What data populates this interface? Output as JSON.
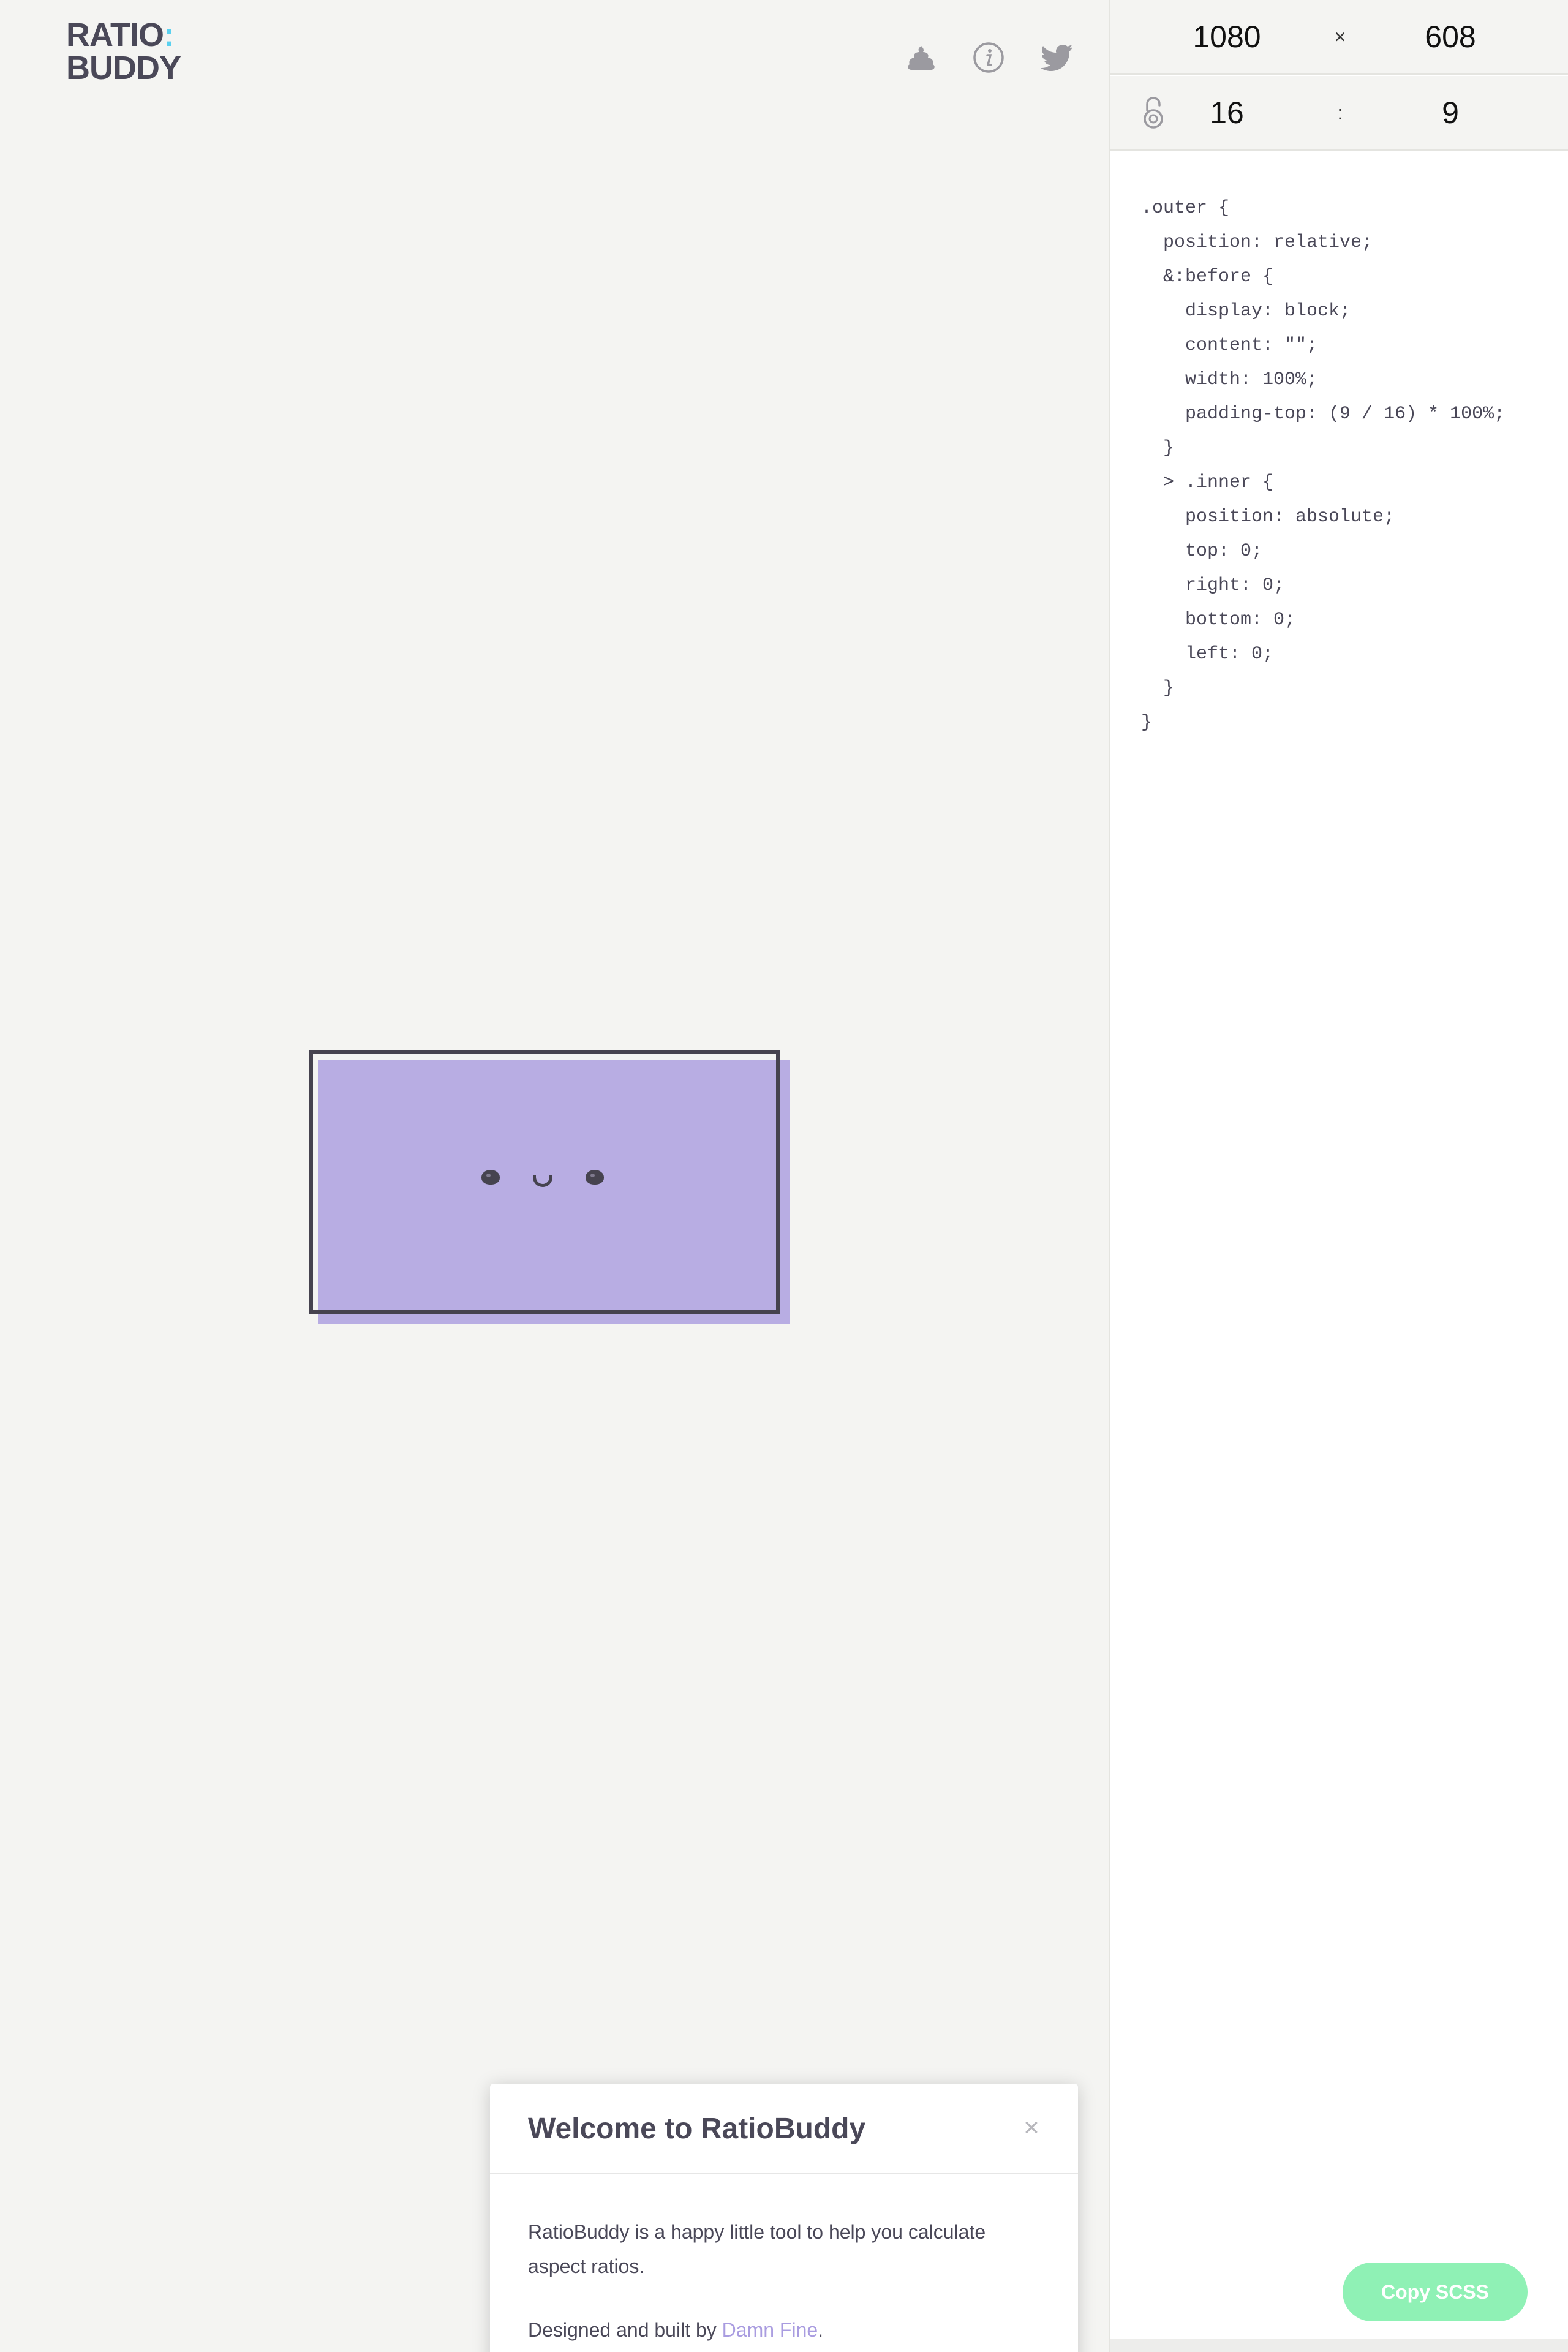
{
  "logo": {
    "line1": "RATIO",
    "colon": ":",
    "line2": "BUDDY"
  },
  "icons": {
    "poop": "poop-icon",
    "info": "info-icon",
    "twitter": "twitter-icon",
    "lock": "unlocked-padlock-icon"
  },
  "dimensions": {
    "width": "1080",
    "times": "×",
    "height": "608"
  },
  "ratio": {
    "left": "16",
    "colon": ":",
    "right": "9"
  },
  "code": {
    "lines": [
      ".outer {",
      "  position: relative;",
      "  &:before {",
      "    display: block;",
      "    content: \"\";",
      "    width: 100%;",
      "    padding-top: (9 / 16) * 100%;",
      "  }",
      "  > .inner {",
      "    position: absolute;",
      "    top: 0;",
      "    right: 0;",
      "    bottom: 0;",
      "    left: 0;",
      "  }",
      "}"
    ]
  },
  "modal": {
    "title": "Welcome to RatioBuddy",
    "close": "×",
    "intro": "RatioBuddy is a happy little tool to help you calculate aspect ratios.",
    "credit_prefix": "Designed and built by ",
    "credit_link": "Damn Fine",
    "credit_suffix": "."
  },
  "copy_button": "Copy SCSS",
  "colors": {
    "preview_fill": "#b8ade3",
    "frame": "#46434f",
    "accent_colon": "#5ad1f0",
    "copy_button": "#8ff1b5",
    "link": "#a99ce0"
  }
}
